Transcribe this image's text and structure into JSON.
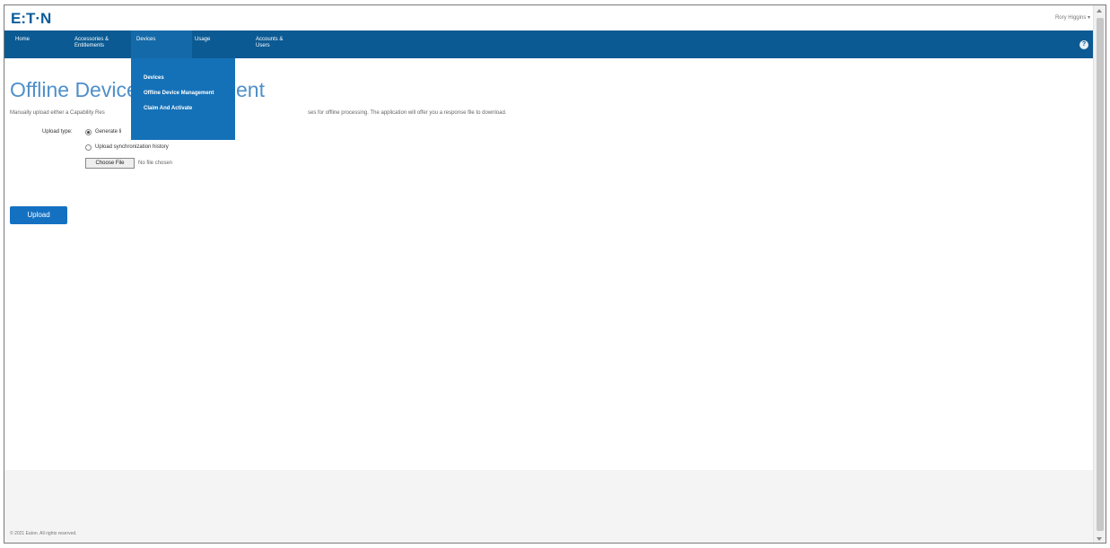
{
  "header": {
    "logo": "E:T·N",
    "user": "Rory Higgins ▾"
  },
  "nav": {
    "items": [
      {
        "label": "Home"
      },
      {
        "label": "Accessories &\nEntitlements"
      },
      {
        "label": "Devices"
      },
      {
        "label": "Usage"
      },
      {
        "label": "Accounts &\nUsers"
      }
    ],
    "help": "?"
  },
  "dropdown": {
    "items": [
      {
        "label": "Devices"
      },
      {
        "label": "Offline Device Management"
      },
      {
        "label": "Claim And Activate"
      }
    ]
  },
  "main": {
    "title_visible_left": "Offline Device",
    "title_visible_right": "ent",
    "description_left": "Manually upload either a Capability Res",
    "description_right": "ses for offline processing. The application will offer you a response file to download.",
    "upload_type_label": "Upload type:",
    "radio_options": [
      {
        "label": "Generate li",
        "checked": true
      },
      {
        "label": "Upload synchronization history",
        "checked": false
      }
    ],
    "file_button": "Choose File",
    "file_status": "No file chosen",
    "upload_button": "Upload"
  },
  "footer": {
    "copyright": "© 2021 Eaton. All rights reserved."
  },
  "colors": {
    "brand": "#0b5a93",
    "dropdown": "#1471b8",
    "title": "#4f8fc9",
    "button": "#1471c2"
  }
}
